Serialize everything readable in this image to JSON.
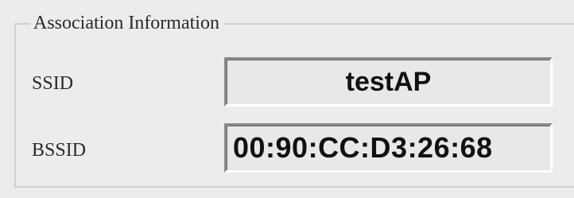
{
  "association": {
    "group_title": "Association Information",
    "ssid": {
      "label": "SSID",
      "value": "testAP"
    },
    "bssid": {
      "label": "BSSID",
      "value": "00:90:CC:D3:26:68"
    }
  }
}
